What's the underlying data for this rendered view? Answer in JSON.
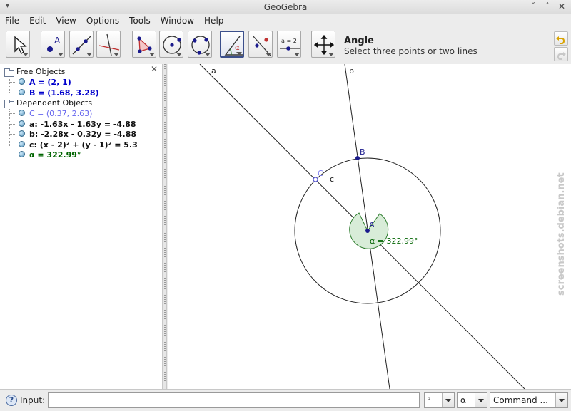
{
  "window": {
    "title": "GeoGebra"
  },
  "menu": [
    "File",
    "Edit",
    "View",
    "Options",
    "Tools",
    "Window",
    "Help"
  ],
  "toolbar": {
    "tool_title": "Angle",
    "tool_description": "Select three points or two lines",
    "tools": [
      {
        "name": "move-tool",
        "icon": "arrow-cursor-icon"
      },
      {
        "name": "new-point-tool",
        "icon": "point-icon",
        "label": "A"
      },
      {
        "name": "line-tool",
        "icon": "line-icon"
      },
      {
        "name": "perpendicular-line-tool",
        "icon": "perpendicular-icon"
      },
      {
        "name": "polygon-tool",
        "icon": "polygon-icon"
      },
      {
        "name": "circle-center-point-tool",
        "icon": "circle-icon"
      },
      {
        "name": "circle-three-points-tool",
        "icon": "circle-three-points-icon"
      },
      {
        "name": "angle-tool",
        "icon": "angle-icon",
        "label": "α"
      },
      {
        "name": "reflect-tool",
        "icon": "reflect-icon"
      },
      {
        "name": "slider-tool",
        "icon": "slider-icon",
        "label": "a = 2"
      },
      {
        "name": "move-graphics-tool",
        "icon": "move-view-icon"
      }
    ]
  },
  "algebra": {
    "free_header": "Free Objects",
    "free": [
      {
        "text": "A = (2, 1)",
        "color": "#0000cc"
      },
      {
        "text": "B = (1.68, 3.28)",
        "color": "#0000cc"
      }
    ],
    "dependent_header": "Dependent Objects",
    "dependent": [
      {
        "text": "C = (0.37, 2.63)",
        "color": "#6666ee"
      },
      {
        "text": "a: -1.63x - 1.63y = -4.88",
        "color": "#111111"
      },
      {
        "text": "b: -2.28x - 0.32y = -4.88",
        "color": "#111111"
      },
      {
        "text": "c: (x - 2)² + (y - 1)² = 5.3",
        "color": "#111111"
      },
      {
        "text": "α = 322.99°",
        "color": "#006400"
      }
    ]
  },
  "graphics": {
    "label_a": "a",
    "label_b": "b",
    "label_c": "c",
    "point_A": "A",
    "point_B": "B",
    "point_C": "C",
    "angle_label": "α = 322.99°"
  },
  "inputbar": {
    "help": "?",
    "label": "Input:",
    "value": "",
    "superscript_combo": "²",
    "symbol_combo": "α",
    "command_combo": "Command ..."
  },
  "watermark": "screenshots.debian.net"
}
